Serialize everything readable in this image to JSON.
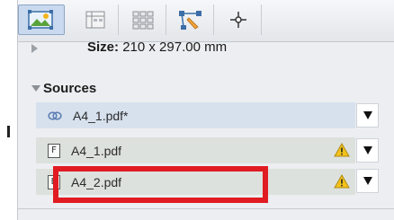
{
  "toolbar": {
    "buttons": [
      {
        "icon": "layout-image-icon",
        "active": true
      },
      {
        "icon": "table-grid-icon",
        "active": false
      },
      {
        "icon": "tile-grid-icon",
        "active": false
      },
      {
        "icon": "path-edit-icon",
        "active": false
      },
      {
        "icon": "crosshair-icon",
        "active": false
      }
    ]
  },
  "page_size": {
    "label": "Size:",
    "value": "210 x 297.00 mm"
  },
  "sources": {
    "title": "Sources",
    "items": [
      {
        "name": "A4_1.pdf*",
        "icon": "link-icon",
        "icon_text": "",
        "warning": false,
        "selected": true
      },
      {
        "name": "A4_1.pdf",
        "icon": "doc-f-icon",
        "icon_text": "F",
        "warning": true,
        "selected": false
      },
      {
        "name": "A4_2.pdf",
        "icon": "doc-b-icon",
        "icon_text": "B",
        "warning": true,
        "selected": false
      }
    ]
  },
  "colors": {
    "highlight": "#e11b22",
    "selected_row": "#d7e1ee",
    "warning": "#f2c21b"
  }
}
